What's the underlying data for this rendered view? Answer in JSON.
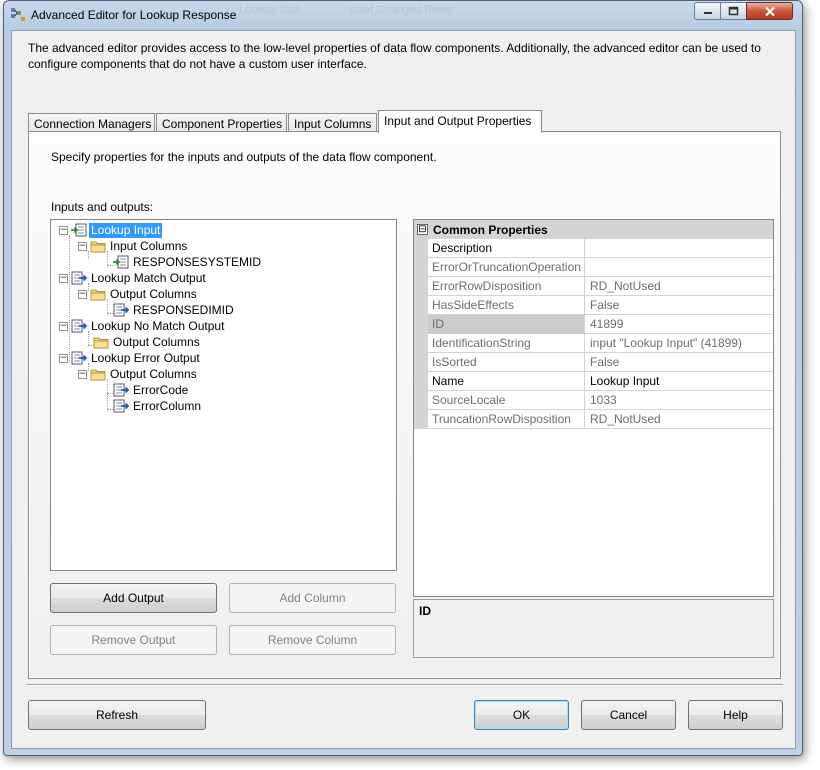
{
  "window": {
    "title": "Advanced Editor for Lookup Response",
    "background_ghost_1": "Lookup Task",
    "background_ghost_2": "Load Changed Rows"
  },
  "description": "The advanced editor provides access to the low-level properties of data flow components. Additionally, the advanced editor can be used to configure components that do not have a custom user interface.",
  "tabs": [
    {
      "label": "Connection Managers",
      "active": false
    },
    {
      "label": "Component Properties",
      "active": false
    },
    {
      "label": "Input Columns",
      "active": false
    },
    {
      "label": "Input and Output Properties",
      "active": true
    }
  ],
  "panel": {
    "instruction": "Specify properties for the inputs and outputs of the data flow component.",
    "inputs_outputs_label": "Inputs and outputs:"
  },
  "tree": [
    {
      "label": "Lookup Input",
      "icon": "input-icon",
      "selected": true,
      "expanded": true
    },
    {
      "label": "Input Columns",
      "icon": "folder-icon",
      "expanded": true
    },
    {
      "label": "RESPONSESYSTEMID",
      "icon": "input-column-icon"
    },
    {
      "label": "Lookup Match Output",
      "icon": "output-icon",
      "expanded": true
    },
    {
      "label": "Output Columns",
      "icon": "folder-icon",
      "expanded": true
    },
    {
      "label": "RESPONSEDIMID",
      "icon": "output-column-icon"
    },
    {
      "label": "Lookup No Match Output",
      "icon": "output-icon",
      "expanded": true
    },
    {
      "label": "Output Columns",
      "icon": "folder-icon"
    },
    {
      "label": "Lookup Error Output",
      "icon": "output-icon",
      "expanded": true
    },
    {
      "label": "Output Columns",
      "icon": "folder-icon",
      "expanded": true
    },
    {
      "label": "ErrorCode",
      "icon": "output-column-icon"
    },
    {
      "label": "ErrorColumn",
      "icon": "output-column-icon"
    }
  ],
  "buttons": {
    "add_output": "Add Output",
    "add_column": "Add Column",
    "remove_output": "Remove Output",
    "remove_column": "Remove Column",
    "refresh": "Refresh",
    "ok": "OK",
    "cancel": "Cancel",
    "help": "Help"
  },
  "properties": {
    "category": "Common Properties",
    "collapse_glyph": "⊟",
    "rows": [
      {
        "name": "Description",
        "value": "",
        "editable": true
      },
      {
        "name": "ErrorOrTruncationOperation",
        "value": "",
        "editable": false
      },
      {
        "name": "ErrorRowDisposition",
        "value": "RD_NotUsed",
        "editable": false
      },
      {
        "name": "HasSideEffects",
        "value": "False",
        "editable": false
      },
      {
        "name": "ID",
        "value": "41899",
        "editable": false,
        "selected": true
      },
      {
        "name": "IdentificationString",
        "value": "input \"Lookup Input\" (41899)",
        "editable": false
      },
      {
        "name": "IsSorted",
        "value": "False",
        "editable": false
      },
      {
        "name": "Name",
        "value": "Lookup Input",
        "editable": true
      },
      {
        "name": "SourceLocale",
        "value": "1033",
        "editable": false
      },
      {
        "name": "TruncationRowDisposition",
        "value": "RD_NotUsed",
        "editable": false
      }
    ]
  },
  "description_pane": {
    "title": "ID"
  },
  "colors": {
    "selection": "#3399ff",
    "titlebar": "#c9d9ec",
    "close_button": "#c9573e"
  }
}
